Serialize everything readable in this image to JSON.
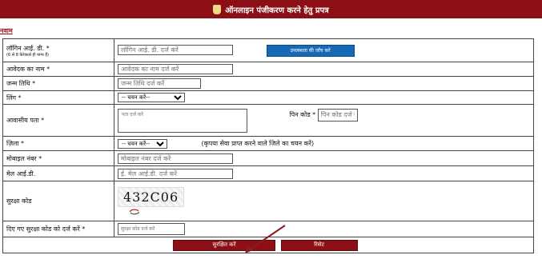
{
  "header": {
    "title": "ऑनलाइन पंजीकरण करने हेतु प्रपत्र"
  },
  "section": {
    "title": "नवाम"
  },
  "fields": {
    "login": {
      "label": "लॉगिन आई. डी. *",
      "hint": "(6 से 8 कैरेक्टर्स ही मान्य हैं)",
      "placeholder": "लॉगिन आई. डी. दर्ज करें",
      "check_button": "उपलब्धता की जाँच करें"
    },
    "name": {
      "label": "आवेदक का नाम *",
      "placeholder": "आवेदक का नाम दर्ज करें"
    },
    "dob": {
      "label": "जन्म तिथि *",
      "placeholder": "जन्म तिथि दर्ज करें"
    },
    "gender": {
      "label": "लिंग *",
      "selected": "-- चयन करें--"
    },
    "address": {
      "label": "आवासीय पता *",
      "placeholder": "पता दर्ज करें"
    },
    "pincode": {
      "label": "पिन कोड *",
      "placeholder": "पिन कोड दर्ज करें"
    },
    "district": {
      "label": "ज़िला *",
      "selected": "-- चयन करें--",
      "note": "(कृपया सेवा प्राप्त करने वाले जिले का चयन करें)"
    },
    "mobile": {
      "label": "मोबाइल नंबर *",
      "placeholder": "मोबाइल नंबर दर्ज करें"
    },
    "email": {
      "label": "मेल आई.डी.",
      "placeholder": "ई. मेल आई.डी. दर्ज करें"
    },
    "captcha": {
      "label": "सुरक्षा कोड",
      "code": "432C06"
    },
    "captcha_input": {
      "label": "दिए गए सुरक्षा कोड को दर्ज करें *",
      "placeholder": "सुरक्षा कोड दर्ज करें"
    }
  },
  "buttons": {
    "submit": "सुरक्षित करें",
    "reset": "रिसेट"
  },
  "colors": {
    "header_bg": "#8b0f14",
    "button_red": "#8b0f14",
    "button_blue": "#1769b5",
    "arrow": "#8b1c1c"
  }
}
